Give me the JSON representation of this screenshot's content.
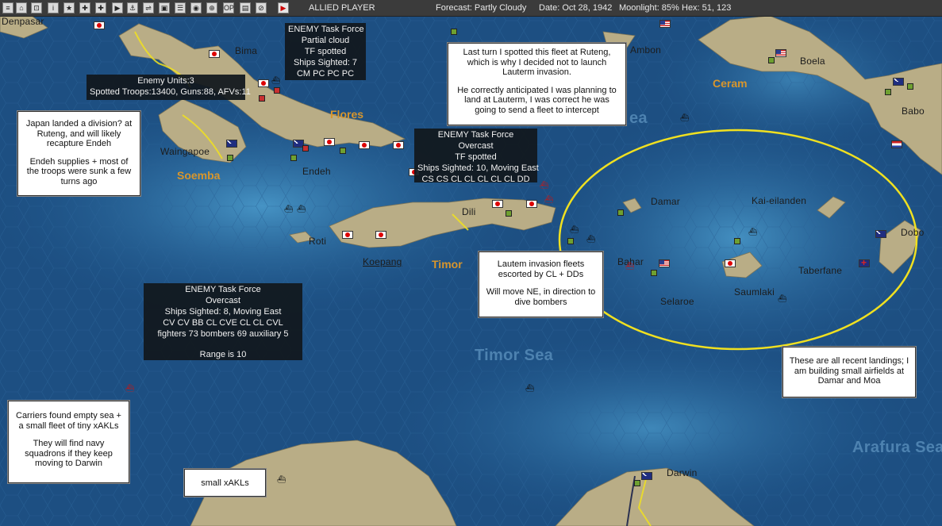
{
  "topbar": {
    "buttons": [
      "≡",
      "⌂",
      "⊡",
      "i",
      "★",
      "✚",
      "✚",
      "▶",
      "⚓",
      "⇌",
      "▣",
      "☰",
      "◉",
      "⊕",
      "OP",
      "▤",
      "⊘",
      "▶"
    ],
    "player": "ALLIED PLAYER",
    "forecast": "Forecast: Partly Cloudy",
    "date": "Date: Oct 28, 1942",
    "moonlight": "Moonlight: 85%",
    "hex": "Hex: 51, 123"
  },
  "places": {
    "denpasar": "Denpasar",
    "bima": "Bima",
    "ambon": "Ambon",
    "boela": "Boela",
    "babo": "Babo",
    "waingapoe": "Waingapoe",
    "endeh": "Endeh",
    "dili": "Dili",
    "roti": "Roti",
    "koepang": "Koepang",
    "damar": "Damar",
    "kai_eilanden": "Kai-eilanden",
    "dobo": "Dobo",
    "bahar": "Bahar",
    "taberfane": "Taberfane",
    "selaroe": "Selaroe",
    "saumlaki": "Saumlaki",
    "darwin": "Darwin"
  },
  "regions": {
    "flores": "Flores",
    "soemba": "Soemba",
    "timor": "Timor",
    "ceram": "Ceram"
  },
  "seas": {
    "timor_sea": "Timor Sea",
    "arafura_sea": "Arafura Sea",
    "banda_partial": "ea"
  },
  "task_force_boxes": {
    "tf_north": [
      "ENEMY Task Force",
      "Partial cloud",
      "TF spotted",
      "Ships Sighted: 7",
      "CM PC PC PC"
    ],
    "enemy_units": [
      "Enemy Units:3",
      "Spotted Troops:13400, Guns:88, AFVs:11"
    ],
    "tf_timor": [
      "ENEMY Task Force",
      "Overcast",
      "TF spotted",
      "Ships Sighted: 10, Moving East",
      "CS CS CL CL CL CL CL DD"
    ],
    "tf_carriers": [
      "ENEMY Task Force",
      "Overcast",
      "Ships Sighted: 8, Moving East",
      "CV CV BB CL CVE CL CL CVL",
      "fighters 73   bombers 69   auxiliary 5",
      "",
      "Range is 10"
    ]
  },
  "notes": {
    "ruteng": [
      "Last turn I spotted this fleet at Ruteng, which is why I decided not to launch Lauterm invasion.",
      "He correctly anticipated I was planning to land at Lauterm, I was correct he was going to send a fleet to intercept"
    ],
    "japan_landed": [
      "Japan landed a division? at Ruteng, and will likely recapture Endeh",
      "Endeh supplies + most of the troops were sunk a few turns ago"
    ],
    "lautem": [
      "Lautem invasion fleets escorted by CL + DDs",
      "Will move NE, in direction to dive bombers"
    ],
    "recent_landings": [
      "These are all recent landings; I am building small airfields at Damar and Moa"
    ],
    "carriers": [
      "Carriers found empty sea + a small fleet of tiny xAKLs",
      "They will find navy squadrons if they keep moving to Darwin"
    ],
    "small_xakls": [
      "small xAKLs"
    ]
  },
  "colors": {
    "sea": "#1d4f82",
    "land": "#b8ad8a",
    "ellipse": "#f0e020",
    "region_label": "#d8962c"
  }
}
